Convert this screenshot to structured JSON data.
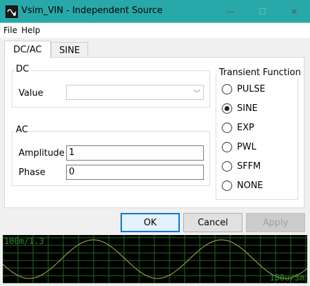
{
  "window": {
    "title": "Vsim_VIN - Independent Source",
    "controls": {
      "minimize": "—",
      "maximize": "☐",
      "close": "✕"
    },
    "accent": "#29a8a9"
  },
  "menu": [
    "File",
    "Help"
  ],
  "tabs": [
    {
      "label": "DC/AC",
      "active": true
    },
    {
      "label": "SINE",
      "active": false
    }
  ],
  "dc": {
    "title": "DC",
    "value_label": "Value",
    "value": ""
  },
  "ac": {
    "title": "AC",
    "amplitude_label": "Amplitude",
    "amplitude": "1",
    "phase_label": "Phase",
    "phase": "0"
  },
  "transient": {
    "title": "Transient Function",
    "options": [
      "PULSE",
      "SINE",
      "EXP",
      "PWL",
      "SFFM",
      "NONE"
    ],
    "selected": "SINE"
  },
  "buttons": {
    "ok": "OK",
    "cancel": "Cancel",
    "apply": "Apply"
  },
  "scope": {
    "top_label": "100m/1.3",
    "bottom_label": "100u/3m",
    "background": "#000000",
    "grid_color": "#1f6b1f",
    "trace_color": "#b9b24a"
  }
}
